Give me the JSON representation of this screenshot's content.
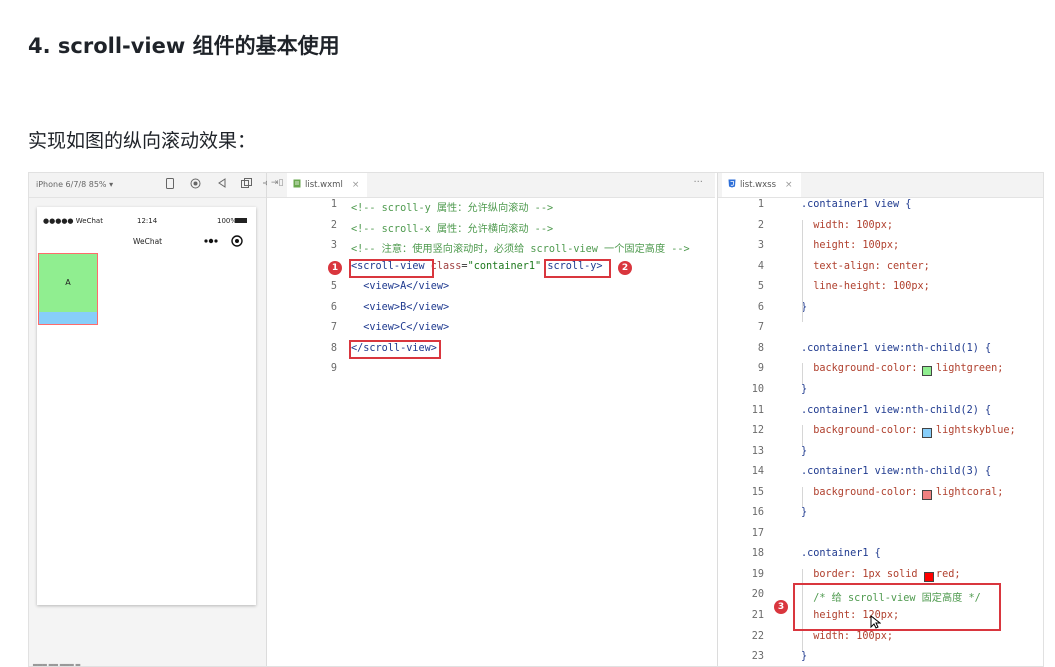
{
  "heading": "4. scroll-view 组件的基本使用",
  "paragraph": "实现如图的纵向滚动效果：",
  "simulator": {
    "device": "iPhone 6/7/8 85% ▾",
    "status_left": "●●●●● WeChat",
    "status_time": "12:14",
    "status_right": "100%",
    "nav_title": "WeChat",
    "box_label": "A",
    "bottom_fragment": "▄▄▄ ▄▄ ▄▄▄ ▄"
  },
  "wxml_tab": {
    "filename": "list.wxml",
    "close": "×",
    "split": "⇥▯",
    "more": "···"
  },
  "wxml_lines": [
    {
      "n": "1",
      "text": "<!-- scroll-y 属性：允许纵向滚动 -->"
    },
    {
      "n": "2",
      "text": "<!-- scroll-x 属性：允许横向滚动 -->"
    },
    {
      "n": "3",
      "text": "<!-- 注意：使用竖向滚动时，必须给 scroll-view 一个固定高度 -->"
    },
    {
      "n": "4",
      "text": "<scroll-view class=\"container1\" scroll-y>"
    },
    {
      "n": "5",
      "text": "  <view>A</view>"
    },
    {
      "n": "6",
      "text": "  <view>B</view>"
    },
    {
      "n": "7",
      "text": "  <view>C</view>"
    },
    {
      "n": "8",
      "text": "</scroll-view>"
    },
    {
      "n": "9",
      "text": ""
    }
  ],
  "wxml_tokens": {
    "open_tag": "<scroll-view",
    "class_attr": "class",
    "class_eq": "=",
    "class_val": "\"container1\"",
    "scroll_attr": "scroll-y>",
    "close_tag": "</scroll-view>"
  },
  "badges": {
    "b1": "1",
    "b2": "2",
    "b3": "3"
  },
  "wxss_tab": {
    "filename": "list.wxss",
    "close": "×"
  },
  "wxss_lines": [
    {
      "n": "1",
      "text": ".container1 view {"
    },
    {
      "n": "2",
      "text": "  width: 100px;"
    },
    {
      "n": "3",
      "text": "  height: 100px;"
    },
    {
      "n": "4",
      "text": "  text-align: center;"
    },
    {
      "n": "5",
      "text": "  line-height: 100px;"
    },
    {
      "n": "6",
      "text": "}"
    },
    {
      "n": "7",
      "text": ""
    },
    {
      "n": "8",
      "text": ".container1 view:nth-child(1) {"
    },
    {
      "n": "9",
      "text": "  background-color: ▢lightgreen;"
    },
    {
      "n": "10",
      "text": "}"
    },
    {
      "n": "11",
      "text": ".container1 view:nth-child(2) {"
    },
    {
      "n": "12",
      "text": "  background-color: ▢lightskyblue;"
    },
    {
      "n": "13",
      "text": "}"
    },
    {
      "n": "14",
      "text": ".container1 view:nth-child(3) {"
    },
    {
      "n": "15",
      "text": "  background-color: ▢lightcoral;"
    },
    {
      "n": "16",
      "text": "}"
    },
    {
      "n": "17",
      "text": ""
    },
    {
      "n": "18",
      "text": ".container1 {"
    },
    {
      "n": "19",
      "text": "  border: 1px solid ▢red;"
    },
    {
      "n": "20",
      "text": "  /* 给 scroll-view 固定高度 */"
    },
    {
      "n": "21",
      "text": "  height: 120px;"
    },
    {
      "n": "22",
      "text": "  width: 100px;"
    },
    {
      "n": "23",
      "text": "}"
    }
  ],
  "colors": {
    "lightgreen": "#90ee90",
    "lightskyblue": "#87cefa",
    "lightcoral": "#f08080",
    "red": "#ff0000",
    "highlight": "#d9363e"
  }
}
